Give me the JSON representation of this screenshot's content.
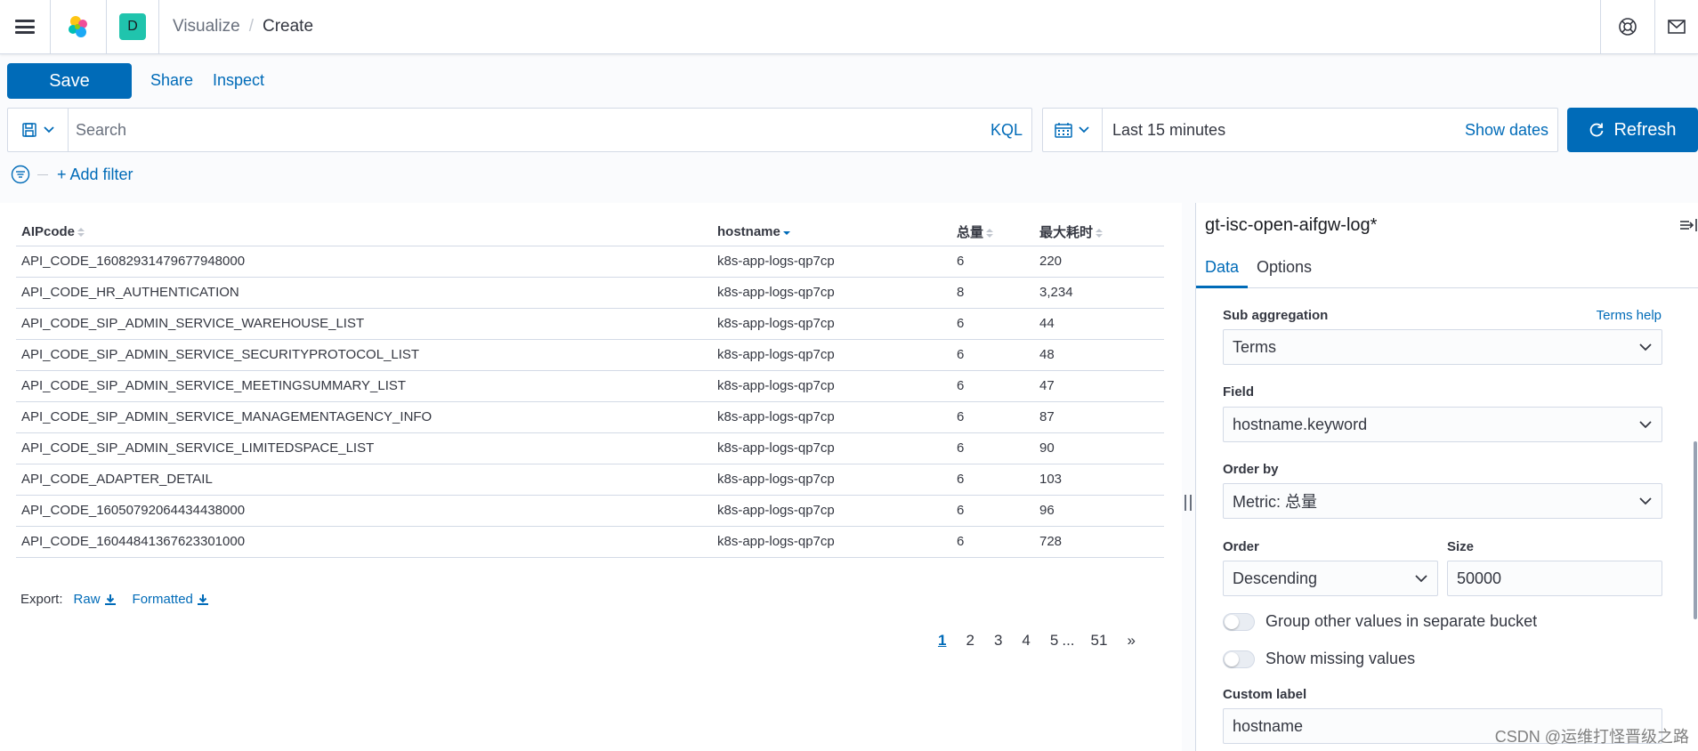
{
  "header": {
    "space_initial": "D",
    "breadcrumbs": [
      "Visualize",
      "Create"
    ]
  },
  "toolbar": {
    "save_label": "Save",
    "share_label": "Share",
    "inspect_label": "Inspect"
  },
  "query": {
    "placeholder": "Search",
    "language": "KQL"
  },
  "time": {
    "range": "Last 15 minutes",
    "show_dates": "Show dates",
    "refresh_label": "Refresh"
  },
  "filters": {
    "add_filter": "+ Add filter"
  },
  "table": {
    "columns": [
      "AIPcode",
      "hostname",
      "总量",
      "最大耗时"
    ],
    "rows": [
      [
        "API_CODE_1608293147967794800​0",
        "k8s-app-logs-qp7cp",
        "6",
        "220"
      ],
      [
        "API_CODE_HR_AUTHENTICATION",
        "k8s-app-logs-qp7cp",
        "8",
        "3,234"
      ],
      [
        "API_CODE_SIP_ADMIN_SERVICE_WAREHOUSE_LIST",
        "k8s-app-logs-qp7cp",
        "6",
        "44"
      ],
      [
        "API_CODE_SIP_ADMIN_SERVICE_SECURITYPROTOCOL_LIST",
        "k8s-app-logs-qp7cp",
        "6",
        "48"
      ],
      [
        "API_CODE_SIP_ADMIN_SERVICE_MEETINGSUMMARY_LIST",
        "k8s-app-logs-qp7cp",
        "6",
        "47"
      ],
      [
        "API_CODE_SIP_ADMIN_SERVICE_MANAGEMENTAGENCY_INFO",
        "k8s-app-logs-qp7cp",
        "6",
        "87"
      ],
      [
        "API_CODE_SIP_ADMIN_SERVICE_LIMITEDSPACE_LIST",
        "k8s-app-logs-qp7cp",
        "6",
        "90"
      ],
      [
        "API_CODE_ADAPTER_DETAIL",
        "k8s-app-logs-qp7cp",
        "6",
        "103"
      ],
      [
        "API_CODE_16050792064434438000",
        "k8s-app-logs-qp7cp",
        "6",
        "96"
      ],
      [
        "API_CODE_16044841367623301000",
        "k8s-app-logs-qp7cp",
        "6",
        "728"
      ]
    ]
  },
  "export": {
    "label": "Export:",
    "raw": "Raw",
    "formatted": "Formatted"
  },
  "pagination": {
    "pages": [
      "1",
      "2",
      "3",
      "4",
      "5"
    ],
    "ellipsis": "...",
    "last": "51",
    "next": "»",
    "active": "1"
  },
  "sidebar": {
    "title": "gt-isc-open-aifgw-log*",
    "tabs": [
      "Data",
      "Options"
    ],
    "sub_aggregation_label": "Sub aggregation",
    "terms_help": "Terms help",
    "sub_aggregation_value": "Terms",
    "field_label": "Field",
    "field_value": "hostname.keyword",
    "order_by_label": "Order by",
    "order_by_value": "Metric: 总量",
    "order_label": "Order",
    "order_value": "Descending",
    "size_label": "Size",
    "size_value": "50000",
    "group_other": "Group other values in separate bucket",
    "show_missing": "Show missing values",
    "custom_label_label": "Custom label",
    "custom_label_value": "hostname"
  },
  "watermark": "CSDN @运维打怪晋级之路",
  "colors": {
    "primary": "#006bb8",
    "space_badge": "#20c4ad"
  }
}
